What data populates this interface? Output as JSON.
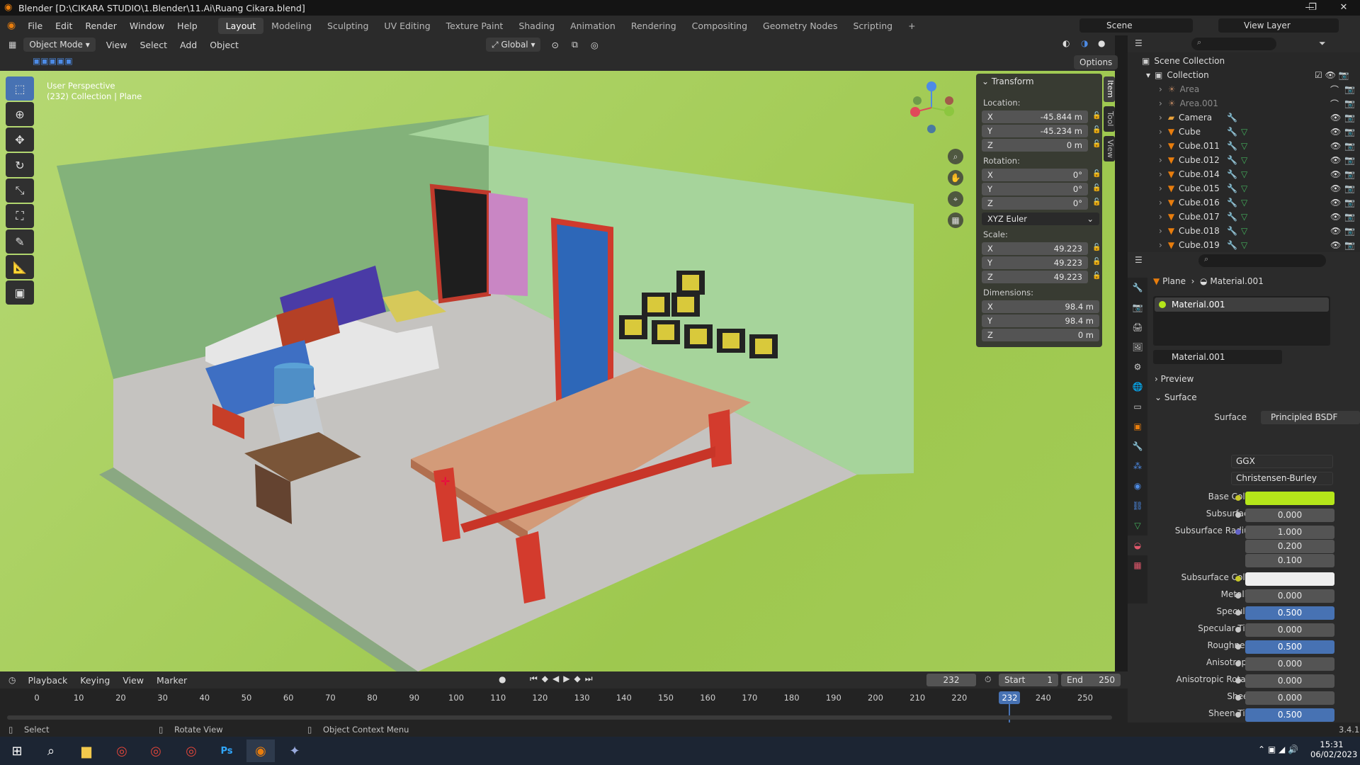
{
  "window": {
    "title": "Blender [D:\\CIKARA STUDIO\\1.Blender\\11.Ai\\Ruang Cikara.blend]",
    "min": "—",
    "max": "❐",
    "close": "✕"
  },
  "menu": [
    "File",
    "Edit",
    "Render",
    "Window",
    "Help"
  ],
  "workspaces": [
    "Layout",
    "Modeling",
    "Sculpting",
    "UV Editing",
    "Texture Paint",
    "Shading",
    "Animation",
    "Rendering",
    "Compositing",
    "Geometry Nodes",
    "Scripting",
    "+"
  ],
  "scene": {
    "label": "Scene",
    "view_layer": "View Layer"
  },
  "viewport_header": {
    "mode": "Object Mode",
    "view": "View",
    "select": "Select",
    "add": "Add",
    "object": "Object",
    "transform": "Global",
    "options": "Options"
  },
  "viewport": {
    "perspective": "User Perspective",
    "collection": "(232) Collection | Plane"
  },
  "gizmo": {
    "x": "X",
    "y": "Y",
    "z": "Z"
  },
  "transform_panel": {
    "title": "Transform",
    "location_label": "Location:",
    "location": [
      {
        "axis": "X",
        "value": "-45.844 m"
      },
      {
        "axis": "Y",
        "value": "-45.234 m"
      },
      {
        "axis": "Z",
        "value": "0 m"
      }
    ],
    "rotation_label": "Rotation:",
    "rotation": [
      {
        "axis": "X",
        "value": "0°"
      },
      {
        "axis": "Y",
        "value": "0°"
      },
      {
        "axis": "Z",
        "value": "0°"
      }
    ],
    "rotation_mode": "XYZ Euler",
    "scale_label": "Scale:",
    "scale": [
      {
        "axis": "X",
        "value": "49.223"
      },
      {
        "axis": "Y",
        "value": "49.223"
      },
      {
        "axis": "Z",
        "value": "49.223"
      }
    ],
    "dimensions_label": "Dimensions:",
    "dimensions": [
      {
        "axis": "X",
        "value": "98.4 m"
      },
      {
        "axis": "Y",
        "value": "98.4 m"
      },
      {
        "axis": "Z",
        "value": "0 m"
      }
    ]
  },
  "side_tabs": [
    "Item",
    "Tool",
    "View"
  ],
  "outliner": {
    "root": "Scene Collection",
    "collection": "Collection",
    "items": [
      "Area",
      "Area.001",
      "Camera",
      "Cube",
      "Cube.011",
      "Cube.012",
      "Cube.014",
      "Cube.015",
      "Cube.016",
      "Cube.017",
      "Cube.018",
      "Cube.019"
    ]
  },
  "properties": {
    "breadcrumb_object": "Plane",
    "breadcrumb_material": "Material.001",
    "slot": "Material.001",
    "material_name": "Material.001",
    "preview": "Preview",
    "surface_section": "Surface",
    "surface_label": "Surface",
    "surface_value": "Principled BSDF",
    "distribution": "GGX",
    "subsurface_method": "Christensen-Burley",
    "rows": [
      {
        "label": "Base Color",
        "value": ""
      },
      {
        "label": "Subsurface",
        "value": "0.000"
      },
      {
        "label": "Subsurface Radius",
        "value": "1.000"
      },
      {
        "label": "",
        "value": "0.200"
      },
      {
        "label": "",
        "value": "0.100"
      },
      {
        "label": "Subsurface Color",
        "value": ""
      },
      {
        "label": "Metallic",
        "value": "0.000"
      },
      {
        "label": "Specular",
        "value": "0.500"
      },
      {
        "label": "Specular Tint",
        "value": "0.000"
      },
      {
        "label": "Roughness",
        "value": "0.500"
      },
      {
        "label": "Anisotropic",
        "value": "0.000"
      },
      {
        "label": "Anisotropic Rota...",
        "value": "0.000"
      },
      {
        "label": "Sheen",
        "value": "0.000"
      },
      {
        "label": "Sheen Tint",
        "value": "0.500"
      }
    ],
    "base_color": "#b5e61a"
  },
  "timeline": {
    "playback": "Playback",
    "keying": "Keying",
    "view": "View",
    "marker": "Marker",
    "current_frame": "232",
    "start_label": "Start",
    "start": "1",
    "end_label": "End",
    "end": "250",
    "ticks": [
      "0",
      "10",
      "20",
      "30",
      "40",
      "50",
      "60",
      "70",
      "80",
      "90",
      "100",
      "110",
      "120",
      "130",
      "140",
      "150",
      "160",
      "170",
      "180",
      "190",
      "200",
      "210",
      "220",
      "2",
      "240",
      "250"
    ],
    "playhead": "232"
  },
  "status": {
    "select": "Select",
    "rotate": "Rotate View",
    "context": "Object Context Menu",
    "version": "3.4.1"
  },
  "taskbar": {
    "time": "15:31",
    "date": "06/02/2023"
  }
}
